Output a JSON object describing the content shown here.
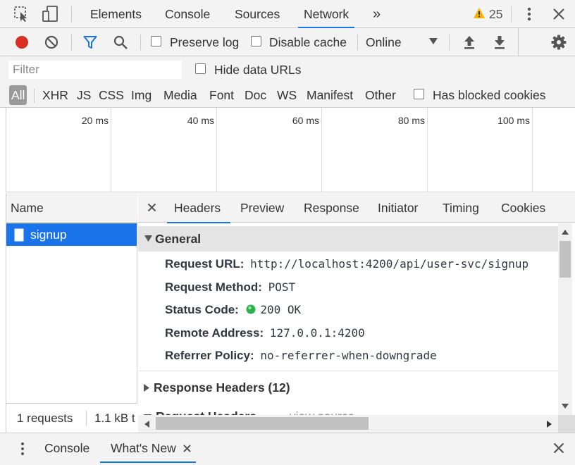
{
  "top_tabs": {
    "elements": "Elements",
    "console": "Console",
    "sources": "Sources",
    "network": "Network",
    "more": "»",
    "warning_count": "25"
  },
  "toolbar": {
    "preserve_log": "Preserve log",
    "disable_cache": "Disable cache",
    "throttling": "Online",
    "record_color": "#d93025"
  },
  "filter": {
    "placeholder": "Filter",
    "hide_data_urls": "Hide data URLs",
    "types": [
      "All",
      "XHR",
      "JS",
      "CSS",
      "Img",
      "Media",
      "Font",
      "Doc",
      "WS",
      "Manifest",
      "Other"
    ],
    "has_blocked_cookies": "Has blocked cookies"
  },
  "overview": {
    "ticks": [
      "20 ms",
      "40 ms",
      "60 ms",
      "80 ms",
      "100 ms"
    ]
  },
  "requests": {
    "column_name": "Name",
    "items": [
      {
        "name": "signup"
      }
    ],
    "summary_count": "1 requests",
    "summary_size": "1.1 kB t"
  },
  "details": {
    "tabs": [
      "Headers",
      "Preview",
      "Response",
      "Initiator",
      "Timing",
      "Cookies"
    ],
    "active_tab": "Headers",
    "general": {
      "title": "General",
      "request_url_label": "Request URL:",
      "request_url": "http://localhost:4200/api/user-svc/signup",
      "request_method_label": "Request Method:",
      "request_method": "POST",
      "status_code_label": "Status Code:",
      "status_code": "200 OK",
      "status_color": "#2bb24c",
      "remote_address_label": "Remote Address:",
      "remote_address": "127.0.0.1:4200",
      "referrer_policy_label": "Referrer Policy:",
      "referrer_policy": "no-referrer-when-downgrade"
    },
    "response_headers": "Response Headers (12)",
    "request_headers": "Request Headers",
    "view_source": "view source"
  },
  "drawer": {
    "console": "Console",
    "whats_new": "What's New"
  }
}
